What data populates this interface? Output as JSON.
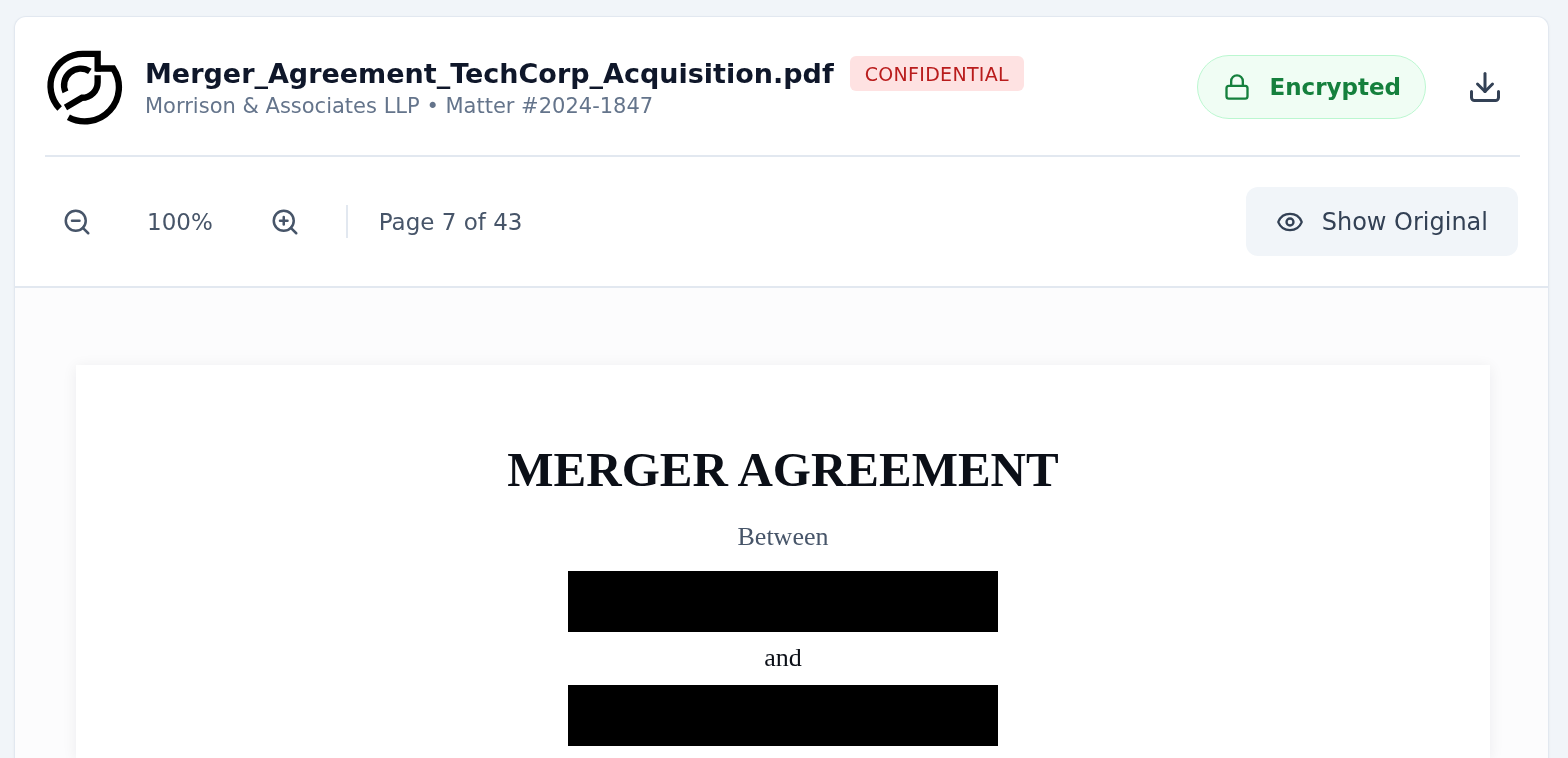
{
  "header": {
    "file_name": "Merger_Agreement_TechCorp_Acquisition.pdf",
    "classification_badge": "CONFIDENTIAL",
    "subtitle": "Morrison & Associates LLP • Matter #2024-1847",
    "status_badge": "Encrypted"
  },
  "toolbar": {
    "zoom_level": "100%",
    "page_indicator": "Page 7 of 43",
    "toggle_button": "Show Original"
  },
  "document": {
    "blocks": [
      {
        "kind": "title",
        "text": "MERGER AGREEMENT"
      },
      {
        "kind": "intro",
        "text": "Between"
      },
      {
        "kind": "redaction"
      },
      {
        "kind": "conjunction",
        "text": "and"
      },
      {
        "kind": "redaction"
      }
    ]
  }
}
